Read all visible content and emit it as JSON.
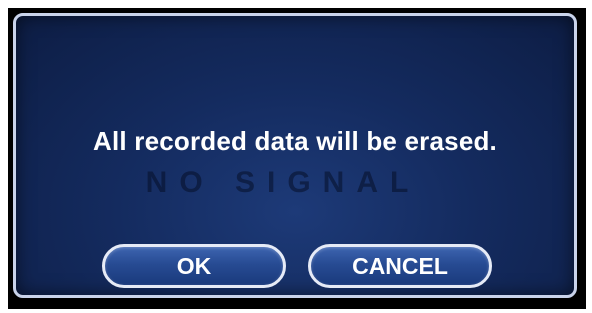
{
  "dialog": {
    "message": "All recorded data will be erased.",
    "background_overlay_text": "NO SIGNAL",
    "buttons": {
      "ok_label": "OK",
      "cancel_label": "CANCEL"
    }
  },
  "colors": {
    "dialog_background": "#142b5f",
    "dialog_border": "#c9d3ea",
    "button_fill": "#274b93",
    "text": "#ffffff"
  }
}
